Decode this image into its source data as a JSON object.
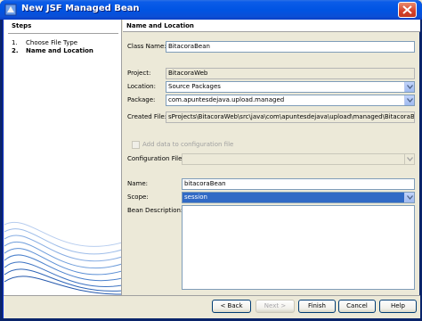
{
  "window": {
    "title": "New JSF Managed Bean"
  },
  "steps": {
    "header": "Steps",
    "items": [
      {
        "num": "1.",
        "label": "Choose File Type"
      },
      {
        "num": "2.",
        "label": "Name and Location"
      }
    ]
  },
  "content": {
    "header": "Name and Location"
  },
  "form": {
    "class_name_label": "Class Name:",
    "class_name_value": "BitacoraBean",
    "project_label": "Project:",
    "project_value": "BitacoraWeb",
    "location_label": "Location:",
    "location_value": "Source Packages",
    "package_label": "Package:",
    "package_value": "com.apuntesdejava.upload.managed",
    "created_file_label": "Created File:",
    "created_file_value": "sProjects\\BitacoraWeb\\src\\java\\com\\apuntesdejava\\upload\\managed\\BitacoraBean.java",
    "add_config_label": "Add data to configuration file",
    "config_file_label": "Configuration File:",
    "config_file_value": "",
    "name_label": "Name:",
    "name_value": "bitacoraBean",
    "scope_label": "Scope:",
    "scope_value": "session",
    "description_label": "Bean Description:",
    "description_value": ""
  },
  "buttons": {
    "back": "< Back",
    "next": "Next >",
    "finish": "Finish",
    "cancel": "Cancel",
    "help": "Help"
  }
}
